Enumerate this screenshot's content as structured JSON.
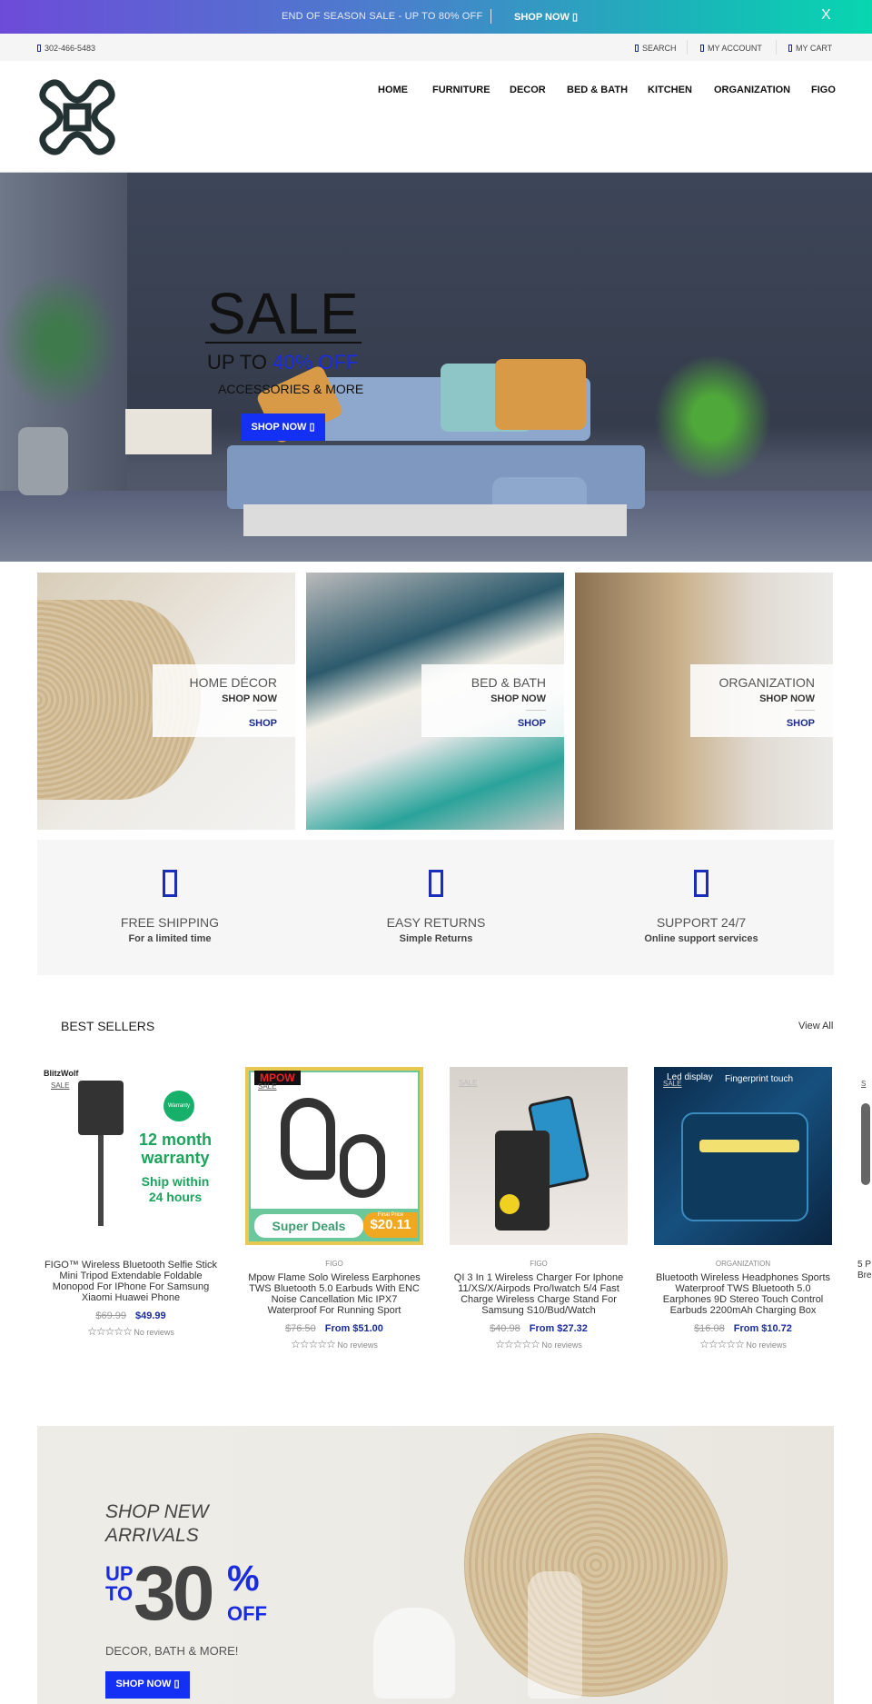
{
  "announcement": {
    "message": "END OF SEASON SALE - UP TO 80% OFF",
    "cta": "SHOP NOW ▯",
    "close": "X"
  },
  "utility": {
    "phone": "302-466-5483",
    "search": "SEARCH",
    "account": "MY ACCOUNT",
    "cart": "MY CART"
  },
  "nav": [
    "HOME",
    "FURNITURE",
    "DECOR",
    "BED & BATH",
    "KITCHEN",
    "ORGANIZATION",
    "FIGO"
  ],
  "hero": {
    "title": "SALE",
    "upto": "UP TO ",
    "discount": "40% OFF",
    "subtitle": "ACCESSORIES & MORE",
    "cta": "SHOP NOW ▯"
  },
  "categories": [
    {
      "title": "HOME DÉCOR",
      "subtitle": "SHOP NOW",
      "link": "SHOP"
    },
    {
      "title": "BED & BATH",
      "subtitle": "SHOP NOW",
      "link": "SHOP"
    },
    {
      "title": "ORGANIZATION",
      "subtitle": "SHOP NOW",
      "link": "SHOP"
    }
  ],
  "features": [
    {
      "title": "FREE SHIPPING",
      "subtitle": "For a limited time"
    },
    {
      "title": "EASY RETURNS",
      "subtitle": "Simple Returns"
    },
    {
      "title": "SUPPORT 24/7",
      "subtitle": "Online support services"
    }
  ],
  "best_sellers": {
    "title": "BEST SELLERS",
    "view_all": "View All",
    "products": [
      {
        "brand": "",
        "badge": "SALE",
        "name": "FIGO™ Wireless Bluetooth Selfie Stick Mini Tripod Extendable Foldable Monopod For IPhone For Samsung Xiaomi Huawei Phone",
        "old_price": "$69.99",
        "price": "$49.99",
        "reviews": "No reviews",
        "img_text": [
          "BlitzWolf",
          "Warranty",
          "12 month warranty",
          "Ship within 24 hours"
        ]
      },
      {
        "brand": "FIGO",
        "badge": "SALE",
        "name": "Mpow Flame Solo Wireless Earphones TWS Bluetooth 5.0 Earbuds With ENC Noise Cancellation Mic IPX7 Waterproof For Running Sport",
        "old_price": "$76.50",
        "price": "From $51.00",
        "reviews": "No reviews",
        "img_text": [
          "MPOW",
          "Super Deals",
          "Final Price",
          "$20.11"
        ]
      },
      {
        "brand": "FIGO",
        "badge": "SALE",
        "name": "QI 3 In 1 Wireless Charger For Iphone 11/XS/X/Airpods Pro/Iwatch 5/4 Fast Charge Wireless Charge Stand For Samsung S10/Bud/Watch",
        "old_price": "$40.98",
        "price": "From $27.32",
        "reviews": "No reviews",
        "img_text": []
      },
      {
        "brand": "ORGANIZATION",
        "badge": "SALE",
        "name": "Bluetooth Wireless Headphones Sports Waterproof TWS Bluetooth 5.0 Earphones 9D Stereo Touch Control Earbuds 2200mAh Charging Box",
        "old_price": "$16.08",
        "price": "From $10.72",
        "reviews": "No reviews",
        "img_text": [
          "Led display",
          "Fingerprint touch"
        ]
      },
      {
        "brand": "",
        "badge": "S",
        "name": "5 P Bre",
        "old_price": "",
        "price": "",
        "reviews": "",
        "img_text": []
      }
    ]
  },
  "promo": {
    "line1": "SHOP NEW",
    "line2": "ARRIVALS",
    "up": "UP",
    "to": "TO",
    "number": "30",
    "percent": "%",
    "off": "OFF",
    "subtitle": "DECOR, BATH & MORE!",
    "cta": "SHOP NOW ▯"
  },
  "colors": {
    "accent": "#1430f5",
    "link": "#1a2c8c",
    "gradient_start": "#6d4bd9",
    "gradient_end": "#08d6b0"
  }
}
